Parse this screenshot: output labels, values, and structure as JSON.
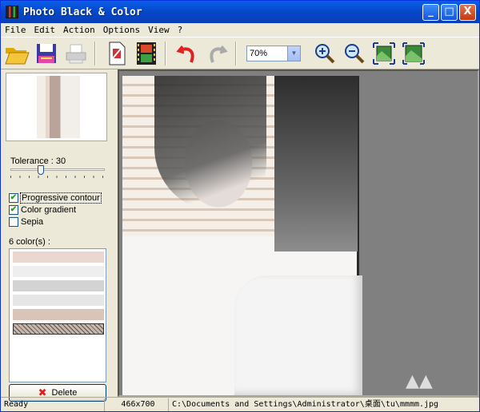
{
  "window": {
    "title": "Photo Black & Color",
    "controls": [
      "_",
      "□",
      "X"
    ]
  },
  "menu": [
    "File",
    "Edit",
    "Action",
    "Options",
    "View",
    "?"
  ],
  "toolbar": {
    "icons": [
      "open-folder-icon",
      "save-icon",
      "print-icon",
      "page-icon",
      "film-icon",
      "undo-icon",
      "redo-icon",
      "zoom-in-icon",
      "zoom-out-icon",
      "fit-window-icon",
      "actual-size-icon"
    ],
    "zoom_value": "70%"
  },
  "panel": {
    "tolerance_label": "Tolerance : 30",
    "tolerance_value": 30,
    "options": [
      {
        "label": "Progressive contour",
        "checked": true
      },
      {
        "label": "Color gradient",
        "checked": true
      },
      {
        "label": "Sepia",
        "checked": false
      }
    ],
    "colors_label": "6 color(s) :",
    "swatches": [
      "#ead7cf",
      "#eeeeee",
      "#d3d3d3",
      "#e6e6e6",
      "#d9c4ba",
      "#c8b6ac"
    ],
    "delete_label": "Delete"
  },
  "status": {
    "state": "Ready",
    "dimensions": "466x700",
    "path": "C:\\Documents and Settings\\Administrator\\桌面\\tu\\mmmm.jpg"
  }
}
